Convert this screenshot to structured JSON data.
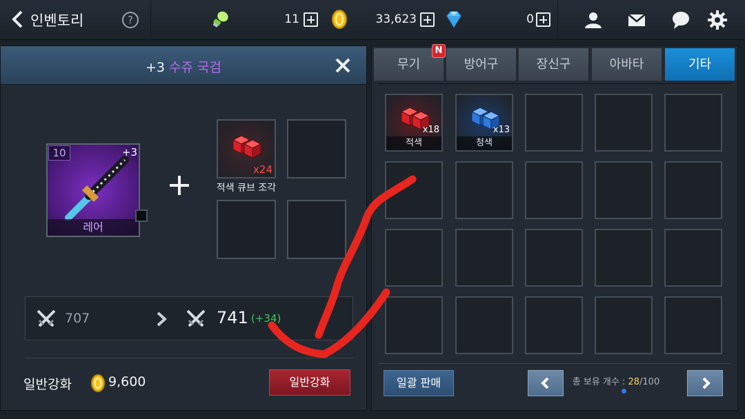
{
  "header": {
    "title": "인벤토리",
    "help_label": "?",
    "currencies": [
      {
        "icon": "energy-icon",
        "value": "",
        "color": "#9ee85a"
      },
      {
        "icon": "ticket-icon",
        "value": "11"
      },
      {
        "icon": "gold-coin-icon",
        "value": "33,623",
        "color": "#f5c21b"
      },
      {
        "icon": "diamond-icon",
        "value": "0",
        "color": "#59c2ff"
      }
    ],
    "icons": [
      "profile-icon",
      "mail-icon",
      "chat-icon",
      "settings-icon"
    ]
  },
  "enhance_panel": {
    "enhance_level": "+3",
    "item_name": "수쥬 국검",
    "weapon": {
      "level": "10",
      "plus": "+3",
      "rarity": "레어",
      "rarity_color": "#b46cf0"
    },
    "material": {
      "name": "적색 큐브 조각",
      "count": "x24",
      "color": "#e8242c"
    },
    "stats": {
      "old_attack": "707",
      "new_attack": "741",
      "diff": "(+34)"
    },
    "enhance_type_label": "일반강화",
    "cost": "9,600",
    "enhance_button": "일반강화"
  },
  "inventory": {
    "tabs": [
      {
        "label": "무기",
        "badge": "N",
        "active": false
      },
      {
        "label": "방어구",
        "active": false
      },
      {
        "label": "장신구",
        "active": false
      },
      {
        "label": "아바타",
        "active": false
      },
      {
        "label": "기타",
        "active": true
      }
    ],
    "items": [
      {
        "name": "적색",
        "count": "x18",
        "color": "red"
      },
      {
        "name": "청색",
        "count": "x13",
        "color": "blue"
      }
    ],
    "bulk_sell_label": "일괄 판매",
    "capacity_label": "총 보유 개수 :",
    "capacity_current": "28",
    "capacity_max": "/100"
  },
  "colors": {
    "accent_blue": "#1a8fd9",
    "enhance_red": "#a82530",
    "annotation_red": "#e8261f"
  }
}
